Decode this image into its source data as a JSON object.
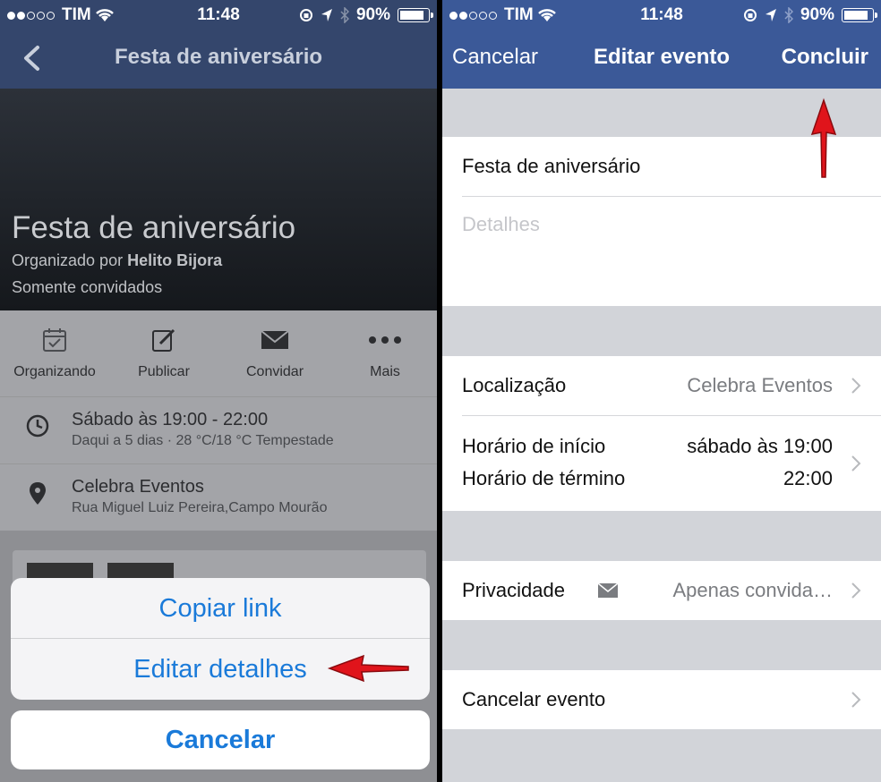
{
  "status": {
    "carrier": "TIM",
    "time": "11:48",
    "battery": "90%",
    "battery_level": 0.9
  },
  "left": {
    "nav_title": "Festa de aniversário",
    "event_title": "Festa de aniversário",
    "organized_prefix": "Organizado por ",
    "organizer": "Helito Bijora",
    "visibility": "Somente convidados",
    "actions": [
      {
        "label": "Organizando",
        "icon": "calendar-check-icon"
      },
      {
        "label": "Publicar",
        "icon": "edit-icon"
      },
      {
        "label": "Convidar",
        "icon": "envelope-icon"
      },
      {
        "label": "Mais",
        "icon": "more-icon"
      }
    ],
    "time_line1": "Sábado às 19:00 - 22:00",
    "time_line2": "Daqui a 5 dias · 28 °C/18 °C Tempestade",
    "place_line1": "Celebra Eventos",
    "place_line2": "Rua Miguel Luiz Pereira,Campo Mourão",
    "sheet": {
      "copy_link": "Copiar link",
      "edit_details": "Editar detalhes",
      "cancel": "Cancelar"
    }
  },
  "right": {
    "cancel_btn": "Cancelar",
    "nav_title": "Editar evento",
    "done_btn": "Concluir",
    "event_name_value": "Festa de aniversário",
    "details_placeholder": "Detalhes",
    "location_label": "Localização",
    "location_value": "Celebra Eventos",
    "start_label": "Horário de início",
    "start_value": "sábado às 19:00",
    "end_label": "Horário de término",
    "end_value": "22:00",
    "privacy_label": "Privacidade",
    "privacy_value": "Apenas convida…",
    "cancel_event": "Cancelar evento"
  },
  "colors": {
    "nav_blue": "#3b5998",
    "link_blue": "#1a7ad9",
    "arrow_red": "#e0141b"
  }
}
